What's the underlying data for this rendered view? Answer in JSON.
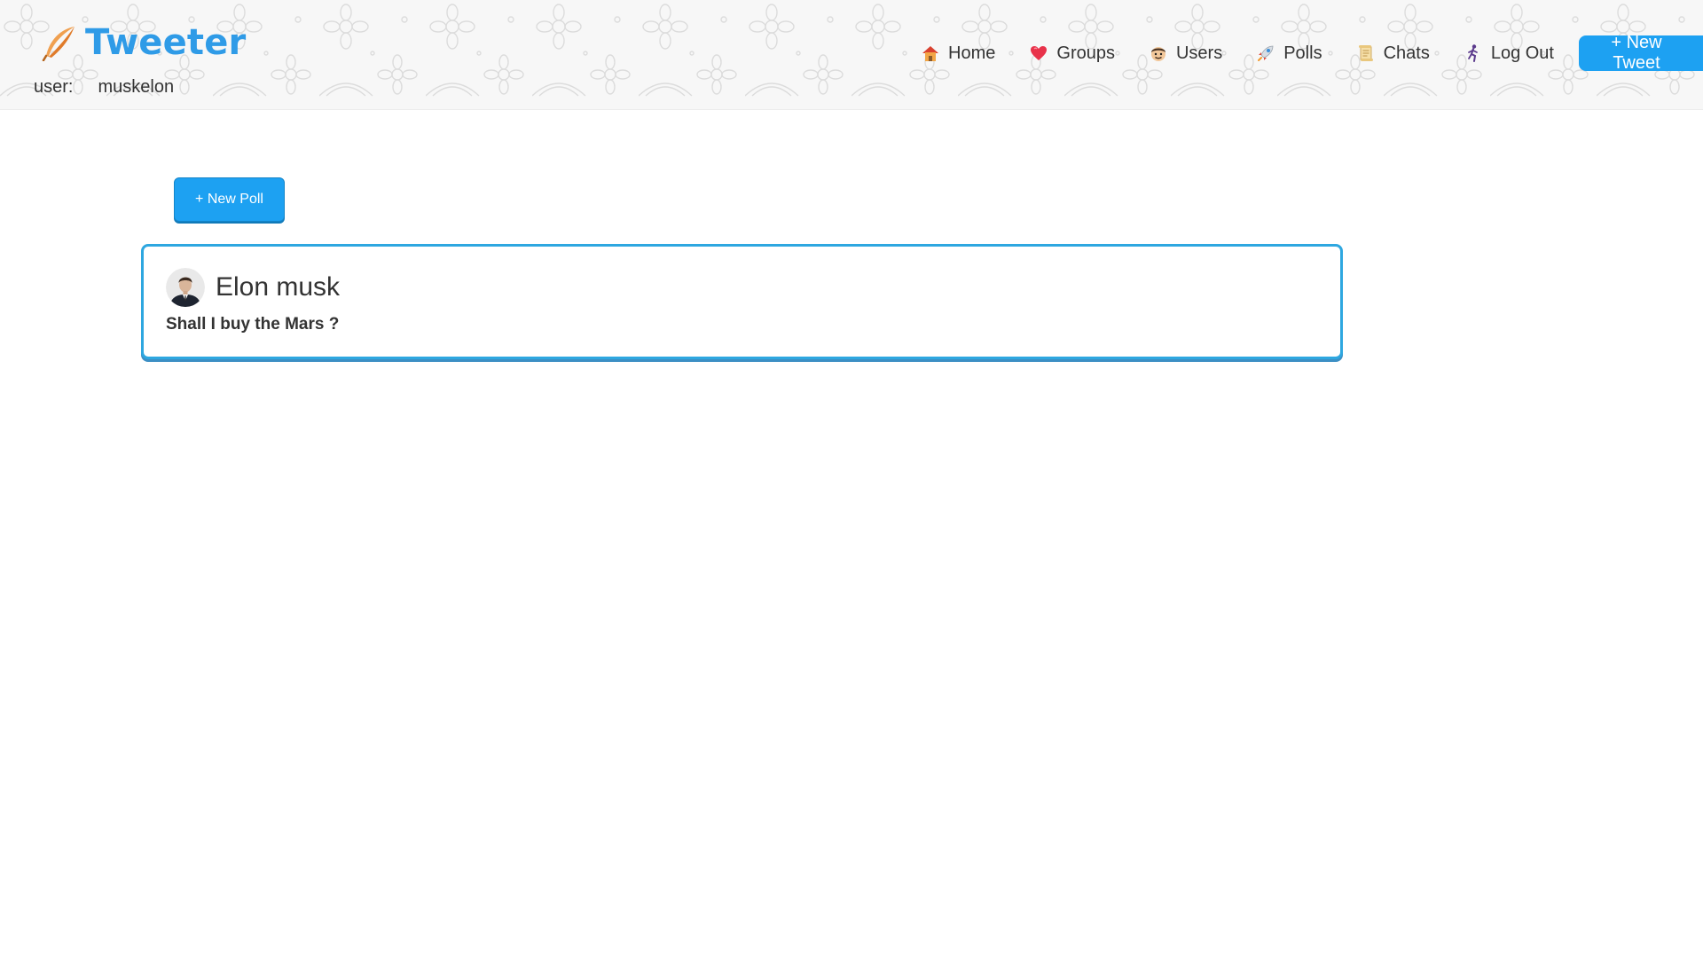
{
  "header": {
    "app_title": "Tweeter",
    "brand_icon": "feather-icon",
    "user_label": "user:",
    "username": "muskelon"
  },
  "nav": {
    "items": [
      {
        "label": "Home",
        "icon": "house-icon"
      },
      {
        "label": "Groups",
        "icon": "heart-icon"
      },
      {
        "label": "Users",
        "icon": "face-icon"
      },
      {
        "label": "Polls",
        "icon": "rocket-icon"
      },
      {
        "label": "Chats",
        "icon": "scroll-icon"
      },
      {
        "label": "Log Out",
        "icon": "running-person-icon"
      }
    ],
    "new_tweet_label": "+ New Tweet"
  },
  "main": {
    "new_poll_label": "+ New Poll",
    "polls": [
      {
        "author": "Elon musk",
        "question": "Shall I buy the Mars ?"
      }
    ]
  },
  "colors": {
    "brand": "#2f9be7",
    "primary_button": "#1da1f2",
    "card_border": "#2ea7e0"
  }
}
